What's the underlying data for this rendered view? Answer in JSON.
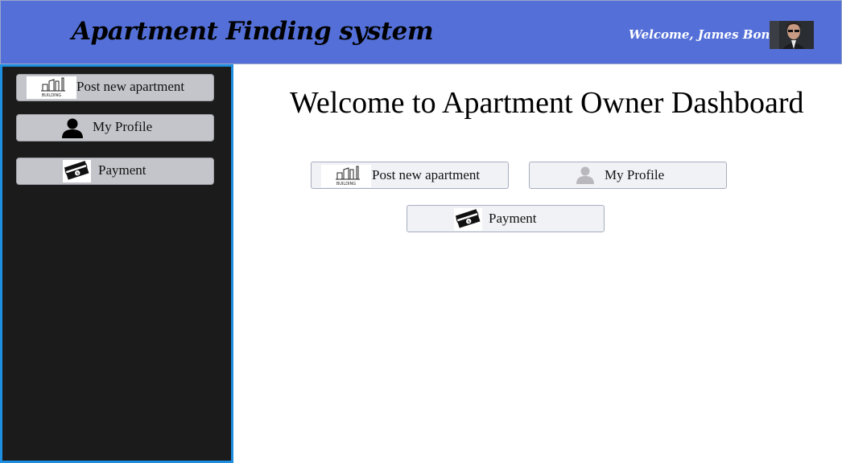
{
  "header": {
    "title": "Apartment Finding system",
    "welcome": "Welcome, James Bond"
  },
  "sidebar": {
    "items": [
      {
        "label": "Post new apartment",
        "icon": "building-logo",
        "logo_text": "BUILDING"
      },
      {
        "label": "My Profile",
        "icon": "user-icon"
      },
      {
        "label": "Payment",
        "icon": "money-icon"
      }
    ]
  },
  "main": {
    "title": "Welcome to Apartment Owner Dashboard",
    "buttons": [
      {
        "label": "Post new apartment",
        "icon": "building-logo",
        "logo_text": "BUILDING"
      },
      {
        "label": "My Profile",
        "icon": "user-icon"
      },
      {
        "label": "Payment",
        "icon": "money-icon"
      }
    ]
  },
  "colors": {
    "header_bg": "#5470d8",
    "sidebar_bg": "#1b1b1b",
    "sidebar_border": "#1e8fe0",
    "sidebar_button": "#c4c5ca",
    "main_button": "#f1f2f6"
  }
}
